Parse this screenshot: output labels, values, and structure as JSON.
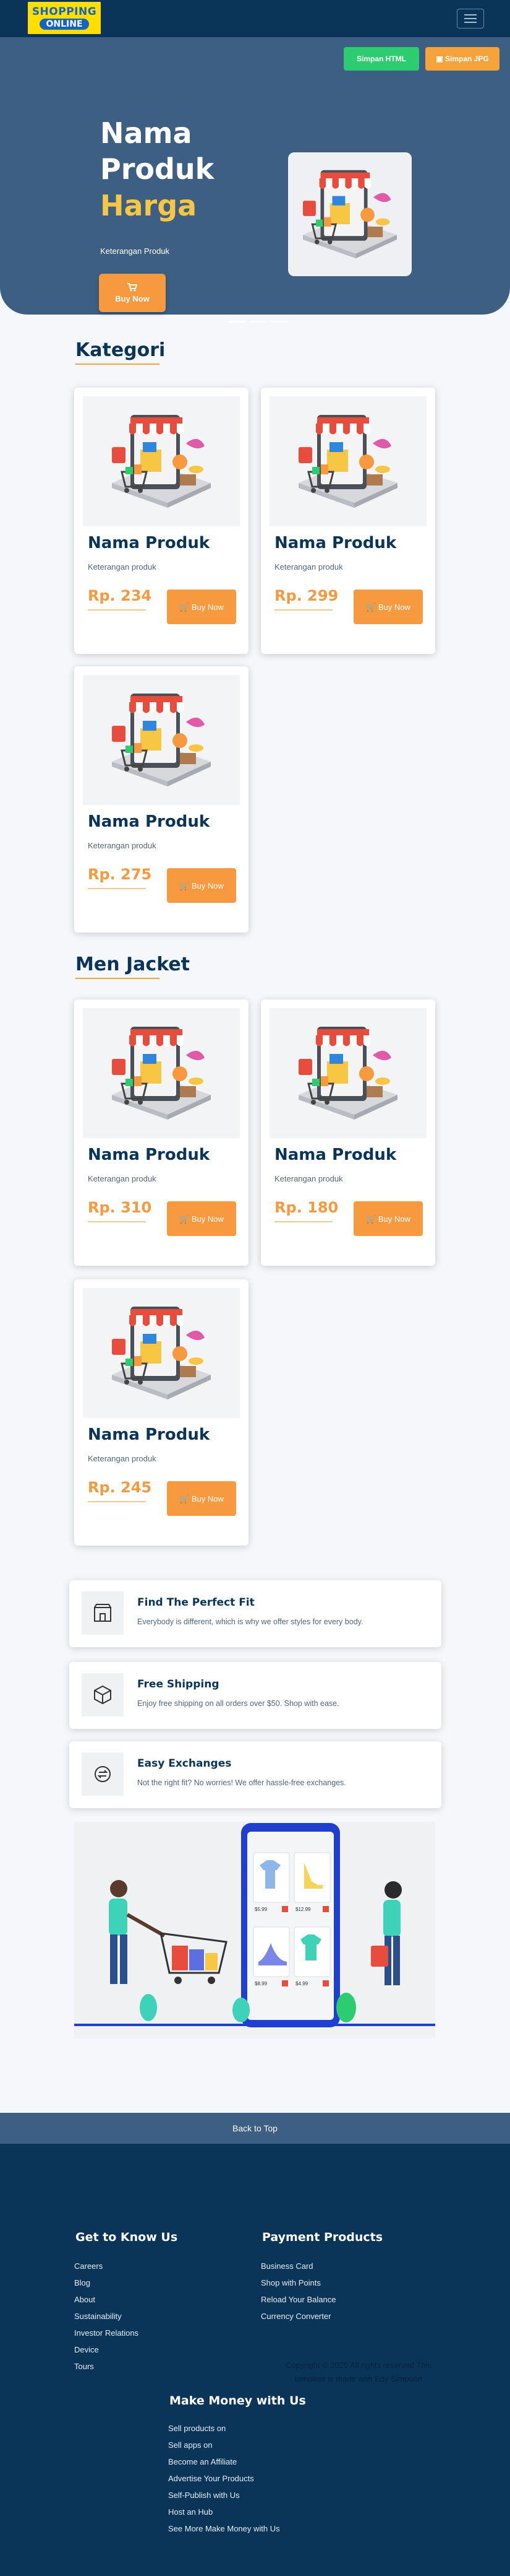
{
  "navbar": {
    "logo_line1": "SHOPPING",
    "logo_line2": "ONLINE"
  },
  "hero": {
    "save_html_label": "Simpan HTML",
    "save_jpg_label": "Simpan JPG",
    "title_line1": "Nama",
    "title_line2": "Produk",
    "price": "Harga",
    "description": "Keterangan Produk",
    "buy_label": "Buy Now",
    "slides": 3,
    "active_slide": 1
  },
  "sections": [
    {
      "title": "Kategori",
      "products": [
        {
          "name": "Nama Produk",
          "desc": "Keterangan produk",
          "price": "Rp. 234",
          "buy": "Buy Now"
        },
        {
          "name": "Nama Produk",
          "desc": "Keterangan produk",
          "price": "Rp. 299",
          "buy": "Buy Now"
        },
        {
          "name": "Nama Produk",
          "desc": "Keterangan produk",
          "price": "Rp. 275",
          "buy": "Buy Now"
        }
      ]
    },
    {
      "title": "Men Jacket",
      "products": [
        {
          "name": "Nama Produk",
          "desc": "Keterangan produk",
          "price": "Rp. 310",
          "buy": "Buy Now"
        },
        {
          "name": "Nama Produk",
          "desc": "Keterangan produk",
          "price": "Rp. 180",
          "buy": "Buy Now"
        },
        {
          "name": "Nama Produk",
          "desc": "Keterangan produk",
          "price": "Rp. 245",
          "buy": "Buy Now"
        }
      ]
    }
  ],
  "features": [
    {
      "icon": "store-icon",
      "title": "Find The Perfect Fit",
      "desc": "Everybody is different, which is why we offer styles for every body."
    },
    {
      "icon": "box-icon",
      "title": "Free Shipping",
      "desc": "Enjoy free shipping on all orders over $50. Shop with ease."
    },
    {
      "icon": "exchange-icon",
      "title": "Easy Exchanges",
      "desc": "Not the right fit? No worries! We offer hassle-free exchanges."
    }
  ],
  "illustration": {
    "prices": [
      "$5.99",
      "$12.99",
      "$8.99",
      "$4.99"
    ]
  },
  "footer": {
    "back_to_top": "Back to Top",
    "col1": {
      "title": "Get to Know Us",
      "links": [
        "Careers",
        "Blog",
        "About",
        "Sustainability",
        "Investor Relations",
        "Device",
        "Tours"
      ]
    },
    "col2": {
      "title": "Payment Products",
      "links": [
        "Business Card",
        "Shop with Points",
        "Reload Your Balance",
        "Currency Converter"
      ]
    },
    "copyright_line1": "Copyright © 2025 All rights reserved This",
    "copyright_line2": "template is made with Edy Simpuon",
    "col3": {
      "title": "Make Money with Us",
      "links": [
        "Sell products on",
        "Sell apps on",
        "Become an Affiliate",
        "Advertise Your Products",
        "Self-Publish with Us",
        "Host an Hub",
        "See More Make Money with Us"
      ]
    }
  },
  "colors": {
    "navy": "#0b3558",
    "hero_blue": "#3c5f83",
    "accent_orange": "#f6993f",
    "price_yellow": "#f7c744",
    "green": "#2ecc71"
  }
}
